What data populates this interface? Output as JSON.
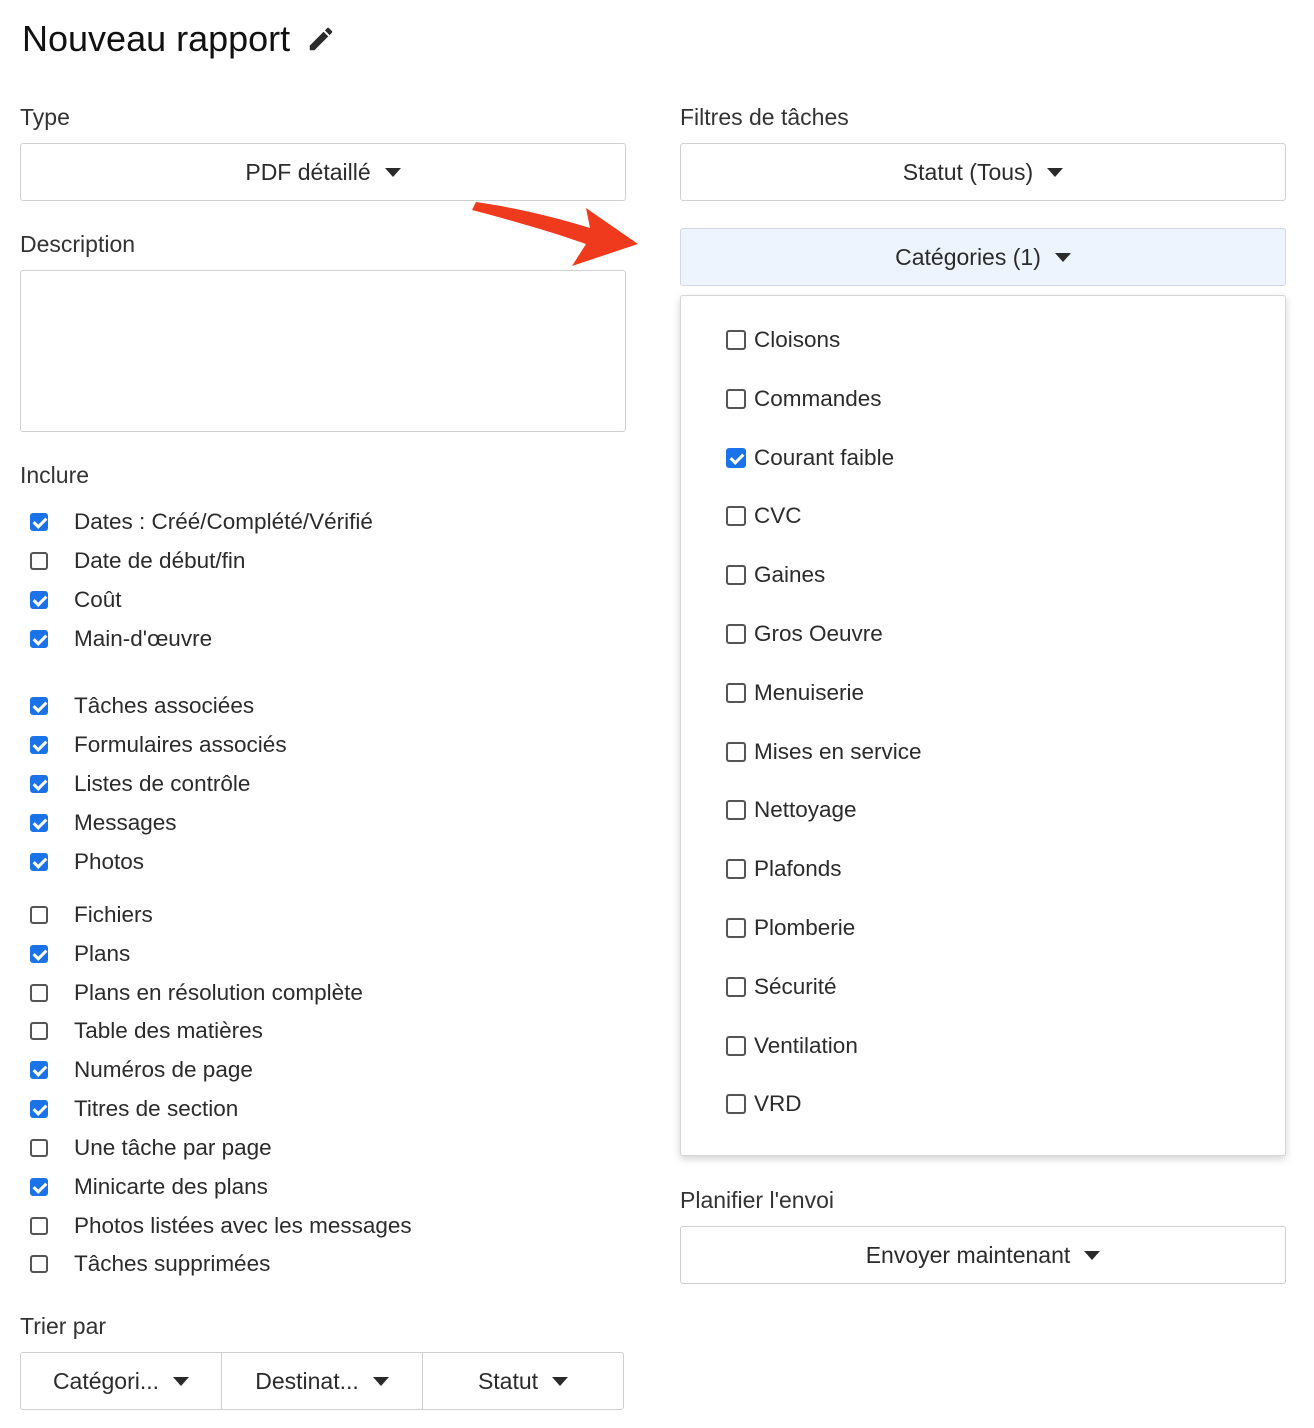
{
  "header": {
    "title": "Nouveau rapport",
    "edit_icon": "pencil-icon"
  },
  "type": {
    "label": "Type",
    "value": "PDF détaillé"
  },
  "description": {
    "label": "Description",
    "value": ""
  },
  "include": {
    "label": "Inclure",
    "items": [
      {
        "label": "Dates : Créé/Complété/Vérifié",
        "checked": true
      },
      {
        "label": "Date de début/fin",
        "checked": false
      },
      {
        "label": "Coût",
        "checked": true
      },
      {
        "label": "Main-d'œuvre",
        "checked": true
      },
      {
        "label": "Tâches associées",
        "checked": true
      },
      {
        "label": "Formulaires associés",
        "checked": true
      },
      {
        "label": "Listes de contrôle",
        "checked": true
      },
      {
        "label": "Messages",
        "checked": true
      },
      {
        "label": "Photos",
        "checked": true
      },
      {
        "label": "Fichiers",
        "checked": false
      },
      {
        "label": "Plans",
        "checked": true
      },
      {
        "label": "Plans en résolution complète",
        "checked": false
      },
      {
        "label": "Table des matières",
        "checked": false
      },
      {
        "label": "Numéros de page",
        "checked": true
      },
      {
        "label": "Titres de section",
        "checked": true
      },
      {
        "label": "Une tâche par page",
        "checked": false
      },
      {
        "label": "Minicarte des plans",
        "checked": true
      },
      {
        "label": "Photos listées avec les messages",
        "checked": false
      },
      {
        "label": "Tâches supprimées",
        "checked": false
      }
    ]
  },
  "sort": {
    "label": "Trier par",
    "options": [
      "Catégori...",
      "Destinat...",
      "Statut"
    ]
  },
  "filters": {
    "label": "Filtres de tâches",
    "status": "Statut (Tous)",
    "categories": "Catégories (1)"
  },
  "categories_menu": {
    "items": [
      {
        "label": "Cloisons",
        "checked": false
      },
      {
        "label": "Commandes",
        "checked": false
      },
      {
        "label": "Courant faible",
        "checked": true
      },
      {
        "label": "CVC",
        "checked": false
      },
      {
        "label": "Gaines",
        "checked": false
      },
      {
        "label": "Gros Oeuvre",
        "checked": false
      },
      {
        "label": "Menuiserie",
        "checked": false
      },
      {
        "label": "Mises en service",
        "checked": false
      },
      {
        "label": "Nettoyage",
        "checked": false
      },
      {
        "label": "Plafonds",
        "checked": false
      },
      {
        "label": "Plomberie",
        "checked": false
      },
      {
        "label": "Sécurité",
        "checked": false
      },
      {
        "label": "Ventilation",
        "checked": false
      },
      {
        "label": "VRD",
        "checked": false
      }
    ]
  },
  "schedule": {
    "label": "Planifier l'envoi",
    "value": "Envoyer maintenant"
  },
  "colors": {
    "accent": "#1a73e8",
    "annotation_arrow": "#f03a1e"
  }
}
